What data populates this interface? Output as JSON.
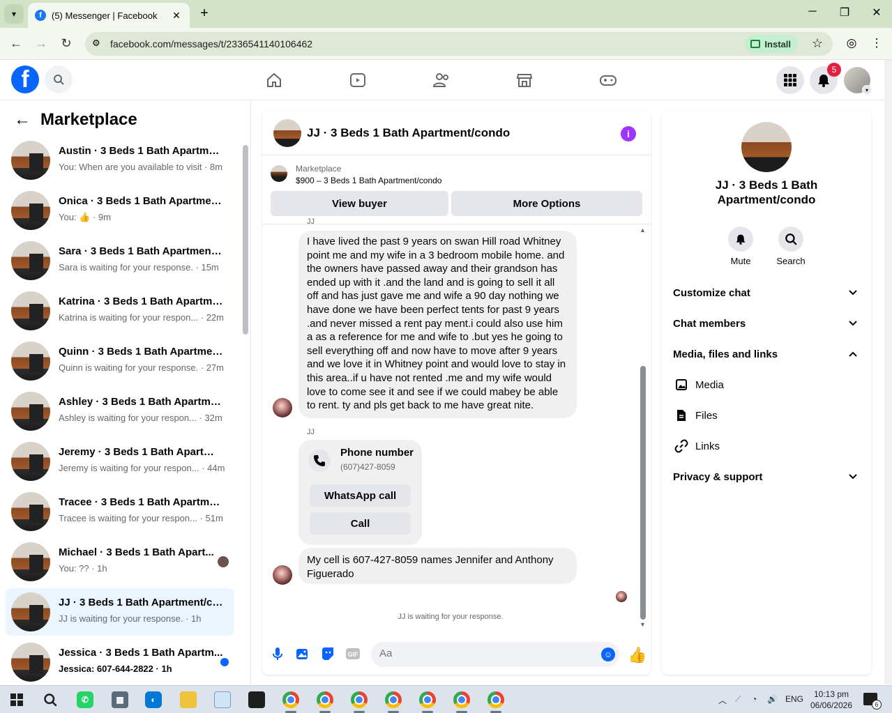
{
  "browser": {
    "tab_title": "(5) Messenger | Facebook",
    "url": "facebook.com/messages/t/2336541140106462",
    "install_label": "Install"
  },
  "header": {
    "notification_count": "5"
  },
  "left_panel": {
    "title": "Marketplace",
    "conversations": [
      {
        "name": "Austin · 3 Beds 1 Bath Apartmen...",
        "sub": "You: When are you available to visit · 8m"
      },
      {
        "name": "Onica · 3 Beds 1 Bath Apartment...",
        "sub": "You: 👍 · 9m"
      },
      {
        "name": "Sara · 3 Beds 1 Bath Apartment/...",
        "sub": "Sara is waiting for your response. · 15m"
      },
      {
        "name": "Katrina · 3 Beds 1 Bath Apartme...",
        "sub": "Katrina is waiting for your respon... · 22m"
      },
      {
        "name": "Quinn · 3 Beds 1 Bath Apartmen...",
        "sub": "Quinn is waiting for your response. · 27m"
      },
      {
        "name": "Ashley · 3 Beds 1 Bath Apartmen...",
        "sub": "Ashley is waiting for your respon... · 32m"
      },
      {
        "name": "Jeremy · 3 Beds 1 Bath Apartme...",
        "sub": "Jeremy is waiting for your respon... · 44m"
      },
      {
        "name": "Tracee · 3 Beds 1 Bath Apartmen...",
        "sub": "Tracee is waiting for your respon... · 51m"
      },
      {
        "name": "Michael · 3 Beds 1 Bath Apart...",
        "sub": "You: ?? · 1h"
      },
      {
        "name": "JJ · 3 Beds 1 Bath Apartment/co...",
        "sub": "JJ is waiting for your response. · 1h"
      },
      {
        "name": "Jessica · 3 Beds 1 Bath Apartm...",
        "sub": "Jessica: 607-644-2822 · 1h"
      }
    ]
  },
  "chat": {
    "title": "JJ · 3 Beds 1 Bath Apartment/condo",
    "marketplace_label": "Marketplace",
    "listing": "$900 – 3 Beds 1 Bath Apartment/condo",
    "view_buyer": "View buyer",
    "more_options": "More Options",
    "sender_top": "JJ",
    "message1": "I have lived the past 9 years on swan Hill road Whitney point me and my wife in a 3 bedroom mobile home. and the owners have passed away and their grandson has ended up with it .and the land and is going to sell it all off and has just gave me and wife a 90 day nothing we have done we have been perfect tents for past 9 years .and never missed a rent pay ment.i could also use him a as a reference for me and wife to .but yes he going to sell everything off and now have to move after 9 years and we love it in Whitney point and would love to stay in this area..if u have not rented .me and my wife would love to come see it and see if we could mabey be able to rent. ty and pls get back to me have great nite.",
    "sender2": "JJ",
    "phone_title": "Phone number",
    "phone_number": "(607)427-8059",
    "whatsapp_label": "WhatsApp call",
    "call_label": "Call",
    "message2": "My cell is 607-427-8059 names Jennifer and Anthony Figuerado",
    "waiting": "JJ is waiting for your response.",
    "composer_placeholder": "Aa"
  },
  "right_panel": {
    "name": "JJ · 3 Beds 1 Bath Apartment/condo",
    "mute": "Mute",
    "search": "Search",
    "customize": "Customize chat",
    "members": "Chat members",
    "media_files": "Media, files and links",
    "media": "Media",
    "files": "Files",
    "links": "Links",
    "privacy": "Privacy & support"
  },
  "taskbar": {
    "lang": "ENG",
    "time": "10:13 pm",
    "date": "06/06/2026",
    "notif_count": "6"
  }
}
